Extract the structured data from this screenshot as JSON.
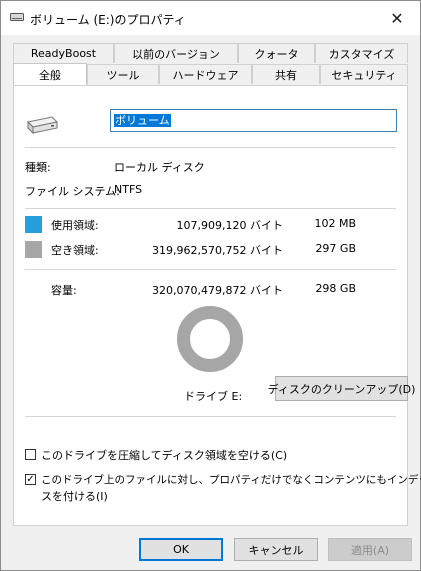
{
  "window": {
    "title": "ボリューム (E:)のプロパティ",
    "close_glyph": "✕"
  },
  "tabs_row1": [
    {
      "label": "ReadyBoost"
    },
    {
      "label": "以前のバージョン"
    },
    {
      "label": "クォータ"
    },
    {
      "label": "カスタマイズ"
    }
  ],
  "tabs_row2": [
    {
      "label": "全般",
      "active": true
    },
    {
      "label": "ツール"
    },
    {
      "label": "ハードウェア"
    },
    {
      "label": "共有"
    },
    {
      "label": "セキュリティ"
    }
  ],
  "general": {
    "volume_name": "ボリューム",
    "type_label": "種類:",
    "type_value": "ローカル ディスク",
    "fs_label": "ファイル システム:",
    "fs_value": "NTFS",
    "used": {
      "label": "使用領域:",
      "bytes": "107,909,120 バイト",
      "size": "102 MB",
      "color": "#26a0da"
    },
    "free": {
      "label": "空き領域:",
      "bytes": "319,962,570,752 バイト",
      "size": "297 GB",
      "color": "#a6a6a6"
    },
    "capacity": {
      "label": "容量:",
      "bytes": "320,070,479,872 バイト",
      "size": "298 GB"
    },
    "drive_label": "ドライブ E:",
    "cleanup_button": "ディスクのクリーンアップ(D)",
    "compress_checkbox": {
      "label": "このドライブを圧縮してディスク領域を空ける(C)",
      "checked": false
    },
    "index_checkbox": {
      "label_line1": "このドライブ上のファイルに対し、プロパティだけでなくコンテンツにもインデック",
      "label_line2": "スを付ける(I)",
      "checked": true,
      "check_glyph": "✓"
    }
  },
  "buttons": {
    "ok": "OK",
    "cancel": "キャンセル",
    "apply": "適用(A)"
  }
}
